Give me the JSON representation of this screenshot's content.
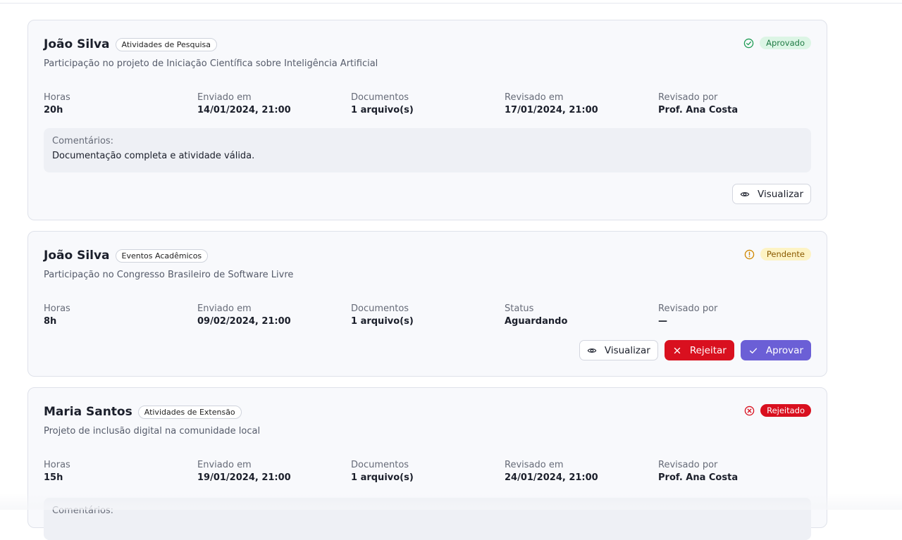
{
  "cards": [
    {
      "name": "João Silva",
      "category": "Atividades de Pesquisa",
      "description": "Participação no projeto de Iniciação Científica sobre Inteligência Artificial",
      "status": "Aprovado",
      "status_icon": "check-circle-icon",
      "fields": [
        {
          "label": "Horas",
          "value": "20h"
        },
        {
          "label": "Enviado em",
          "value": "14/01/2024, 21:00"
        },
        {
          "label": "Documentos",
          "value": "1 arquivo(s)"
        },
        {
          "label": "Revisado em",
          "value": "17/01/2024, 21:00"
        },
        {
          "label": "Revisado por",
          "value": "Prof. Ana Costa"
        }
      ],
      "comment_label": "Comentários:",
      "comment_text": "Documentação completa e atividade válida.",
      "view_label": "Visualizar"
    },
    {
      "name": "João Silva",
      "category": "Eventos Acadêmicos",
      "description": "Participação no Congresso Brasileiro de Software Livre",
      "status": "Pendente",
      "status_icon": "alert-circle-icon",
      "fields": [
        {
          "label": "Horas",
          "value": "8h"
        },
        {
          "label": "Enviado em",
          "value": "09/02/2024, 21:00"
        },
        {
          "label": "Documentos",
          "value": "1 arquivo(s)"
        },
        {
          "label": "Status",
          "value": "Aguardando"
        },
        {
          "label": "Revisado por",
          "value": "—"
        }
      ],
      "view_label": "Visualizar",
      "reject_label": "Rejeitar",
      "approve_label": "Aprovar"
    },
    {
      "name": "Maria Santos",
      "category": "Atividades de Extensão",
      "description": "Projeto de inclusão digital na comunidade local",
      "status": "Rejeitado",
      "status_icon": "x-circle-icon",
      "fields": [
        {
          "label": "Horas",
          "value": "15h"
        },
        {
          "label": "Enviado em",
          "value": "19/01/2024, 21:00"
        },
        {
          "label": "Documentos",
          "value": "1 arquivo(s)"
        },
        {
          "label": "Revisado em",
          "value": "24/01/2024, 21:00"
        },
        {
          "label": "Revisado por",
          "value": "Prof. Ana Costa"
        }
      ],
      "comment_label": "Comentários:"
    }
  ],
  "colors": {
    "approved": "#1f9d55",
    "pending": "#d08700",
    "rejected": "#d9101f",
    "approve_button": "#6b5fd6"
  }
}
